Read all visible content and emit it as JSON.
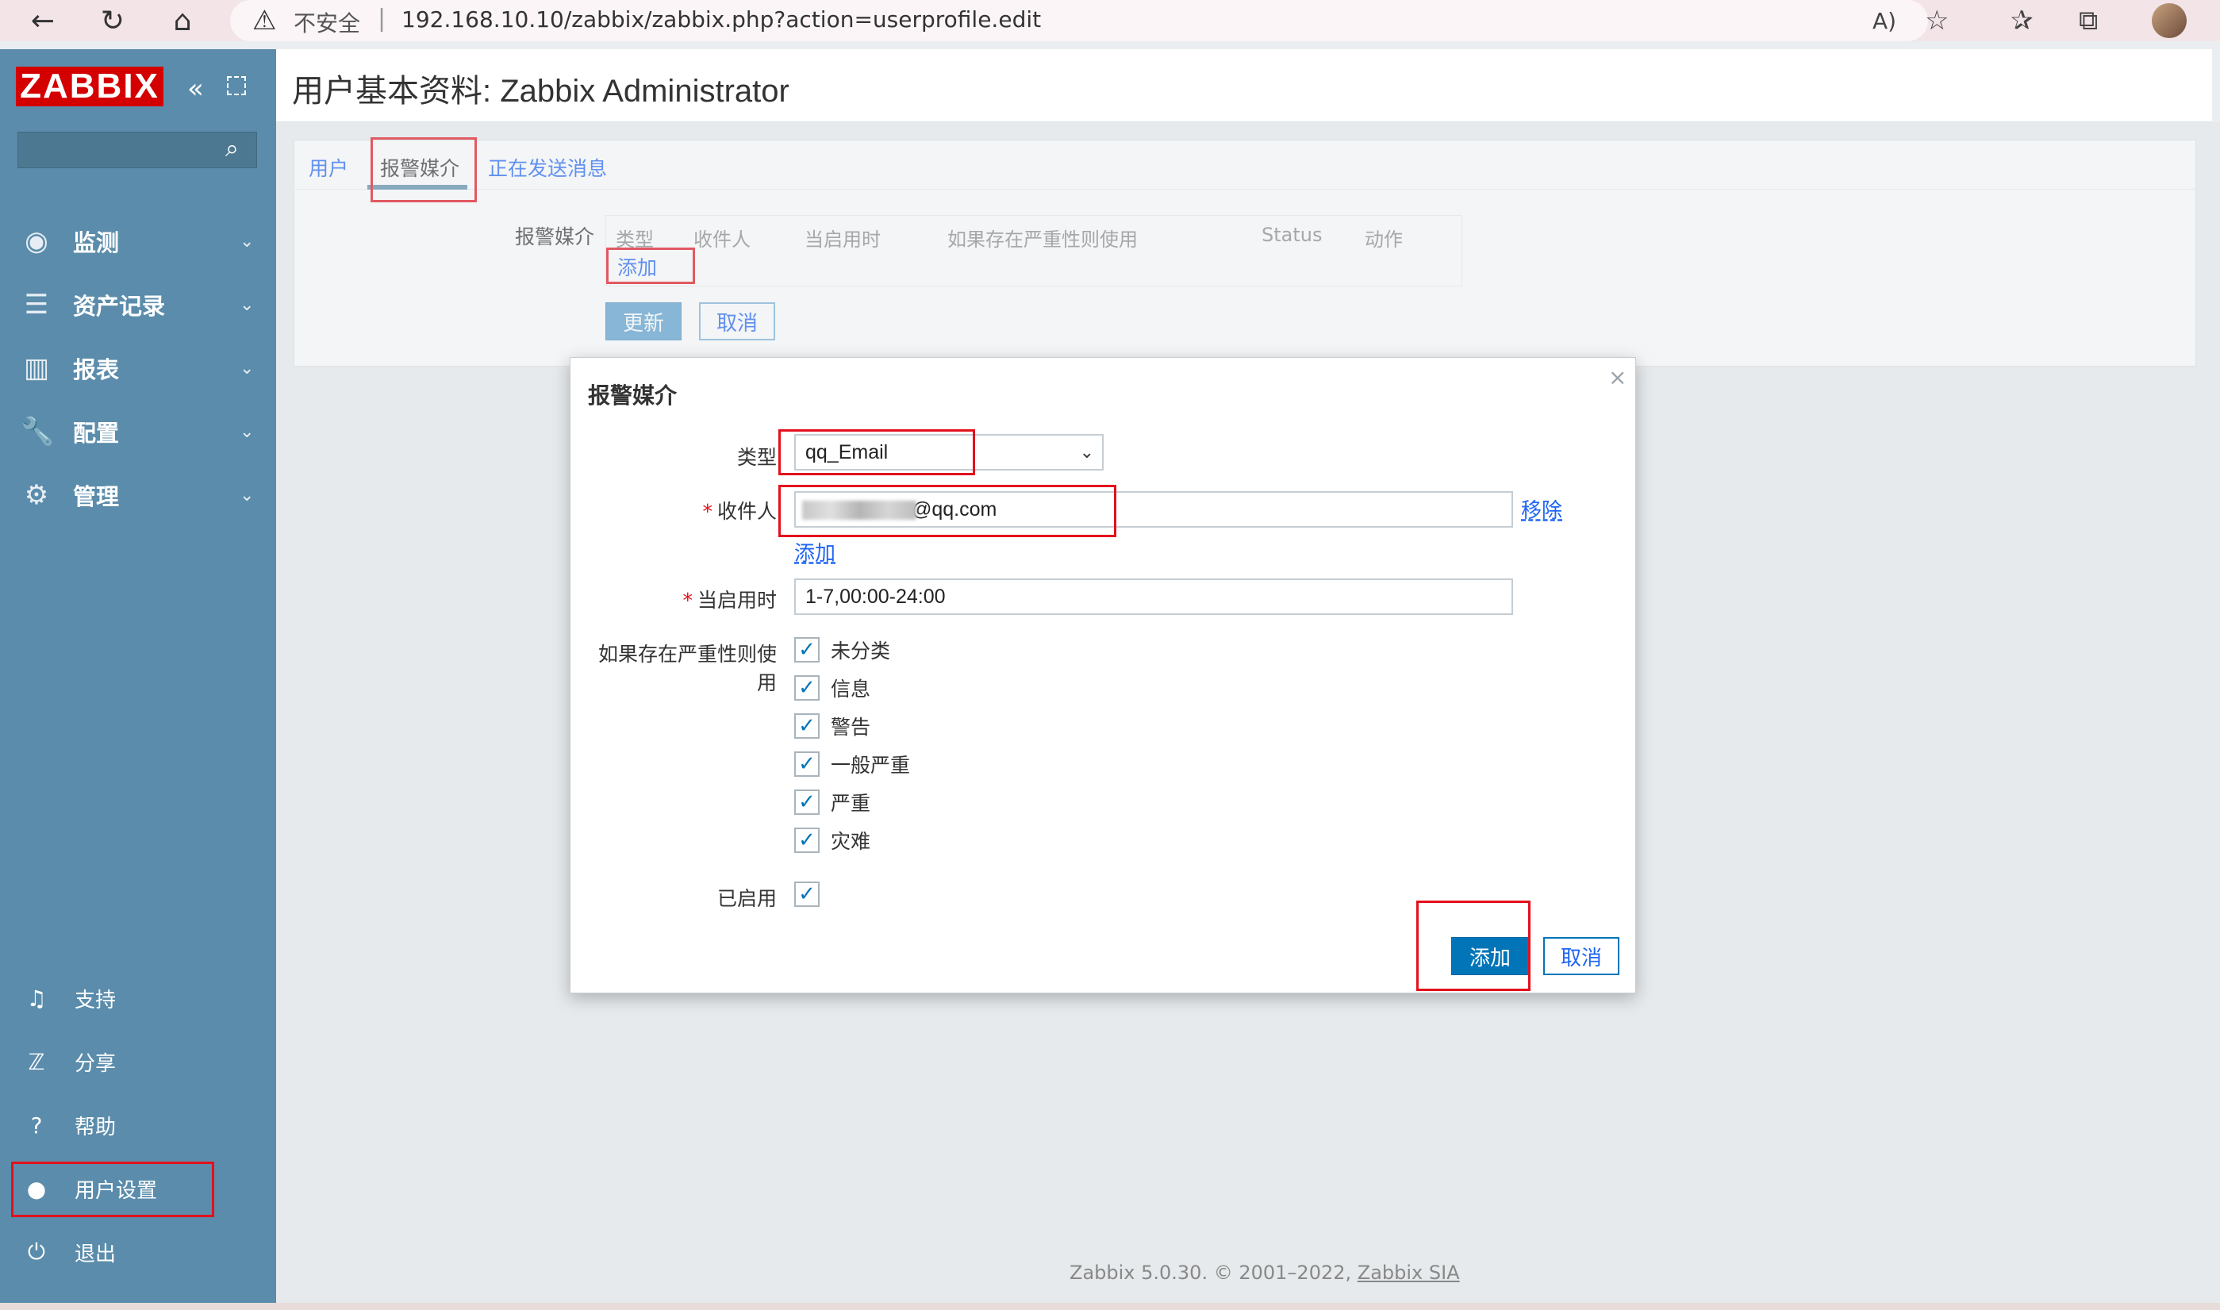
{
  "browser": {
    "security_label": "不安全",
    "separator": "|",
    "url": "192.168.10.10/zabbix/zabbix.php?action=userprofile.edit"
  },
  "sidebar": {
    "logo": "ZABBIX",
    "search_placeholder": "",
    "menu": [
      {
        "label": "监测",
        "icon": "eye-icon"
      },
      {
        "label": "资产记录",
        "icon": "list-icon"
      },
      {
        "label": "报表",
        "icon": "bar-chart-icon"
      },
      {
        "label": "配置",
        "icon": "wrench-icon"
      },
      {
        "label": "管理",
        "icon": "gear-icon"
      }
    ],
    "bottom": [
      {
        "label": "支持",
        "icon": "headset-icon"
      },
      {
        "label": "分享",
        "icon": "share-icon"
      },
      {
        "label": "帮助",
        "icon": "help-icon"
      },
      {
        "label": "用户设置",
        "icon": "user-icon"
      },
      {
        "label": "退出",
        "icon": "power-icon"
      }
    ]
  },
  "page": {
    "title": "用户基本资料: Zabbix Administrator",
    "tabs": [
      "用户",
      "报警媒介",
      "正在发送消息"
    ],
    "media_label": "报警媒介",
    "table_headers": [
      "类型",
      "收件人",
      "当启用时",
      "如果存在严重性则使用",
      "Status",
      "动作"
    ],
    "add_link": "添加",
    "update_button": "更新",
    "cancel_button": "取消"
  },
  "modal": {
    "title": "报警媒介",
    "close": "×",
    "type_label": "类型",
    "type_value": "qq_Email",
    "recipient_label": "收件人",
    "recipient_value": "@qq.com",
    "remove_link": "移除",
    "add_recipient_link": "添加",
    "when_active_label": "当启用时",
    "when_active_value": "1-7,00:00-24:00",
    "severity_label": "如果存在严重性则使用",
    "severities": [
      "未分类",
      "信息",
      "警告",
      "一般严重",
      "严重",
      "灾难"
    ],
    "enabled_label": "已启用",
    "add_button": "添加",
    "cancel_button": "取消"
  },
  "footer": {
    "text": "Zabbix 5.0.30. © 2001–2022, ",
    "link": "Zabbix SIA"
  },
  "colors": {
    "sidebar": "#5b8cab",
    "accent": "#0275b8",
    "logo": "#d40000",
    "highlight": "#e3101d"
  }
}
